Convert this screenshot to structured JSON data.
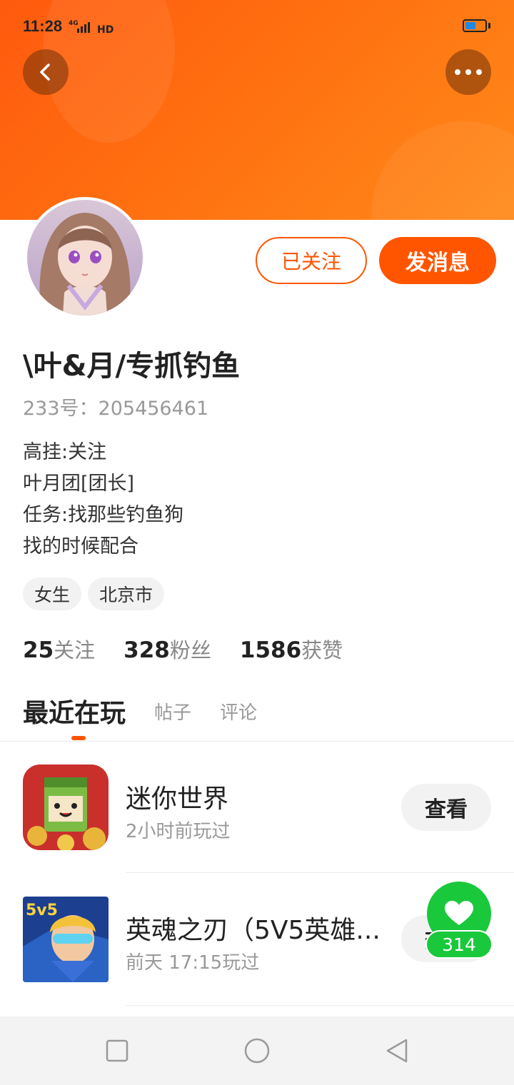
{
  "status_bar": {
    "time": "11:28",
    "network": "4G HD",
    "battery_level": 0.55,
    "battery_color": "#1e88e5"
  },
  "header": {
    "back_icon": "chevron-left-icon",
    "more_icon": "more-dots-icon",
    "gradient_colors": [
      "#ff5a0e",
      "#ff8a1a"
    ]
  },
  "profile": {
    "avatar_icon": "avatar-anime-girl",
    "follow_label": "已关注",
    "message_label": "发消息",
    "username": "\\叶&月/专抓钓鱼",
    "user_id": "233号：205456461",
    "bio_lines": [
      "高挂:关注",
      "叶月团[团长]",
      "任务:找那些钓鱼狗",
      "找的时候配合"
    ],
    "tags": [
      "女生",
      "北京市"
    ],
    "stats": [
      {
        "num": "25",
        "label": "关注"
      },
      {
        "num": "328",
        "label": "粉丝"
      },
      {
        "num": "1586",
        "label": "获赞"
      }
    ]
  },
  "tabs": [
    {
      "label": "最近在玩",
      "active": true
    },
    {
      "label": "帖子",
      "active": false
    },
    {
      "label": "评论",
      "active": false
    }
  ],
  "games": [
    {
      "name": "迷你世界",
      "played": "2小时前玩过",
      "action": "查看",
      "icon": "mini-world-icon"
    },
    {
      "name": "英魂之刃（5V5英雄...",
      "played": "前天 17:15玩过",
      "action": "查看",
      "icon": "hero-blade-icon"
    }
  ],
  "like_float": {
    "count": "314",
    "icon": "heart-icon",
    "color": "#1ac83c"
  },
  "accent_color": "#ff5500",
  "nav_bar": {
    "icons": [
      "square-icon",
      "circle-icon",
      "triangle-back-icon"
    ]
  }
}
